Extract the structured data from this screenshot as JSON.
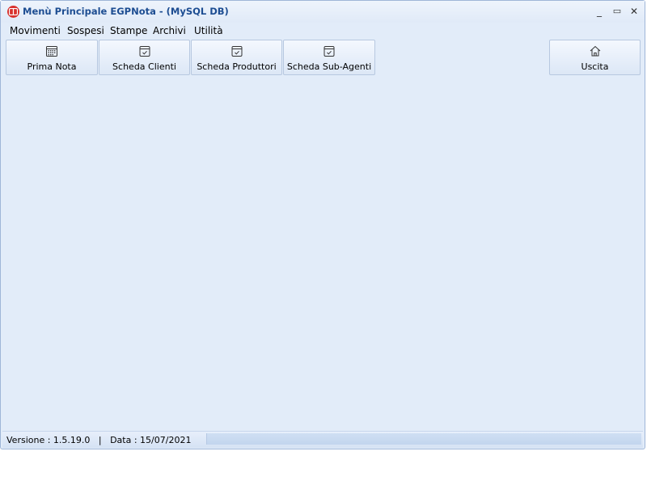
{
  "window": {
    "title": "Menù Principale EGPNota - (MySQL DB)",
    "controls": {
      "minimize": "_",
      "maximize": "▭",
      "close": "✕"
    }
  },
  "menu": {
    "items": [
      "Movimenti",
      "Sospesi",
      "Stampe",
      "Archivi",
      "Utilità"
    ]
  },
  "toolbar": {
    "buttons": [
      {
        "label": "Prima Nota",
        "icon": "calendar-icon"
      },
      {
        "label": "Scheda Clienti",
        "icon": "calendar-check-icon"
      },
      {
        "label": "Scheda Produttori",
        "icon": "calendar-check-icon"
      },
      {
        "label": "Scheda Sub-Agenti",
        "icon": "calendar-check-icon"
      }
    ],
    "exit": {
      "label": "Uscita",
      "icon": "home-icon"
    }
  },
  "status": {
    "text": "Versione : 1.5.19.0   |   Data : 15/07/2021"
  },
  "colors": {
    "title_text": "#1d4d92",
    "app_icon": "#d8312d",
    "window_bg": "#e2ecf9"
  }
}
